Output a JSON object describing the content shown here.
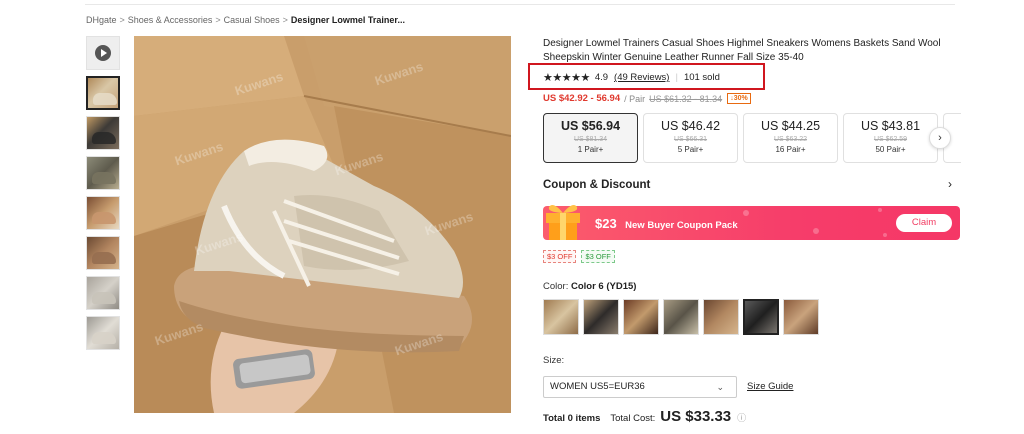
{
  "breadcrumb": {
    "items": [
      "DHgate",
      "Shoes & Accessories",
      "Casual Shoes"
    ],
    "current": "Designer Lowmel Trainer...",
    "separator": ">"
  },
  "gallery": {
    "thumbnails": [
      "video",
      "image-1",
      "image-2",
      "image-3",
      "image-4",
      "image-5",
      "image-6",
      "image-7"
    ],
    "active_index": 1,
    "watermark": "Kuwans"
  },
  "product": {
    "title": "Designer Lowmel Trainers Casual Shoes Highmel Sneakers Womens Baskets Sand Wool Sheepskin Winter Genuine Leather Runner Fall Size 35-40",
    "stars": "★★★★★",
    "rating": "4.9",
    "reviews": "(49 Reviews)",
    "rating_separator": "|",
    "sold": "101 sold",
    "price_range": "US $42.92 - 56.94",
    "pair_unit": "/ Pair",
    "old_price_range": "US $61.32 - 81.34",
    "discount": "↓30%"
  },
  "tiers": [
    {
      "price": "US $56.94",
      "old": "US $81.34",
      "qty": "1 Pair+",
      "selected": true
    },
    {
      "price": "US $46.42",
      "old": "US $66.31",
      "qty": "5 Pair+",
      "selected": false
    },
    {
      "price": "US $44.25",
      "old": "US $63.22",
      "qty": "16 Pair+",
      "selected": false
    },
    {
      "price": "US $43.81",
      "old": "US $62.59",
      "qty": "50 Pair+",
      "selected": false
    }
  ],
  "coupon": {
    "heading": "Coupon & Discount",
    "amount": "$23",
    "description": "New Buyer Coupon Pack",
    "claim_label": "Claim",
    "chips": [
      "$3 OFF",
      "$3 OFF"
    ]
  },
  "color": {
    "label": "Color:",
    "selected_name": "Color 6 (YD15)",
    "selected_index": 5,
    "swatch_count": 7
  },
  "size": {
    "label": "Size:",
    "selected": "WOMEN US5=EUR36",
    "guide_label": "Size Guide"
  },
  "totals": {
    "items": "Total 0 items",
    "cost_label": "Total Cost:",
    "cost": "US $33.33",
    "info_icon": "ⓘ"
  },
  "colors": {
    "accent_red": "#e03a2f",
    "highlight_box": "#d0161f",
    "coupon_pink": "#f63d6a",
    "chip_green": "#2a9a3c"
  }
}
